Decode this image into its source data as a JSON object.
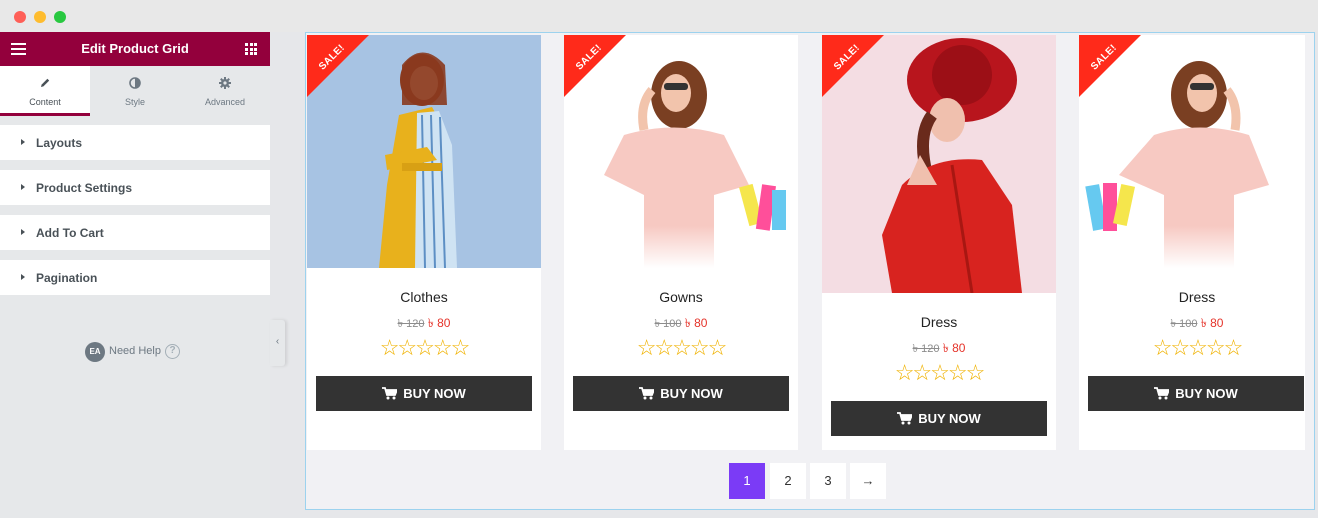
{
  "window": {
    "title": ""
  },
  "panel": {
    "title": "Edit Product Grid",
    "tabs": [
      {
        "label": "Content",
        "icon": "pencil-icon",
        "active": true
      },
      {
        "label": "Style",
        "icon": "half-circle-icon",
        "active": false
      },
      {
        "label": "Advanced",
        "icon": "gear-icon",
        "active": false
      }
    ],
    "sections": [
      {
        "label": "Layouts"
      },
      {
        "label": "Product Settings"
      },
      {
        "label": "Add To Cart"
      },
      {
        "label": "Pagination"
      }
    ],
    "help": {
      "badge": "EA",
      "label": "Need Help",
      "icon": "question-icon"
    }
  },
  "products": [
    {
      "ribbon": "SALE!",
      "name": "Clothes",
      "old_price": "৳ 120",
      "new_price": "৳ 80",
      "rating": 0,
      "stars": "☆☆☆☆☆",
      "button": "BUY NOW"
    },
    {
      "ribbon": "SALE!",
      "name": "Gowns",
      "old_price": "৳ 100",
      "new_price": "৳ 80",
      "rating": 0,
      "stars": "☆☆☆☆☆",
      "button": "BUY NOW"
    },
    {
      "ribbon": "SALE!",
      "name": "Dress",
      "old_price": "৳ 120",
      "new_price": "৳ 80",
      "rating": 0,
      "stars": "☆☆☆☆☆",
      "button": "BUY NOW"
    },
    {
      "ribbon": "SALE!",
      "name": "Dress",
      "old_price": "৳ 100",
      "new_price": "৳ 80",
      "rating": 0,
      "stars": "☆☆☆☆☆",
      "button": "BUY NOW"
    }
  ],
  "pagination": {
    "pages": [
      "1",
      "2",
      "3"
    ],
    "current": "1",
    "next": "→"
  },
  "colors": {
    "brand": "#93003c",
    "sale": "#ff2a1a",
    "price_new": "#e5332a",
    "star": "#f0b200",
    "button": "#333333",
    "pagination_active": "#7b3bf6"
  }
}
